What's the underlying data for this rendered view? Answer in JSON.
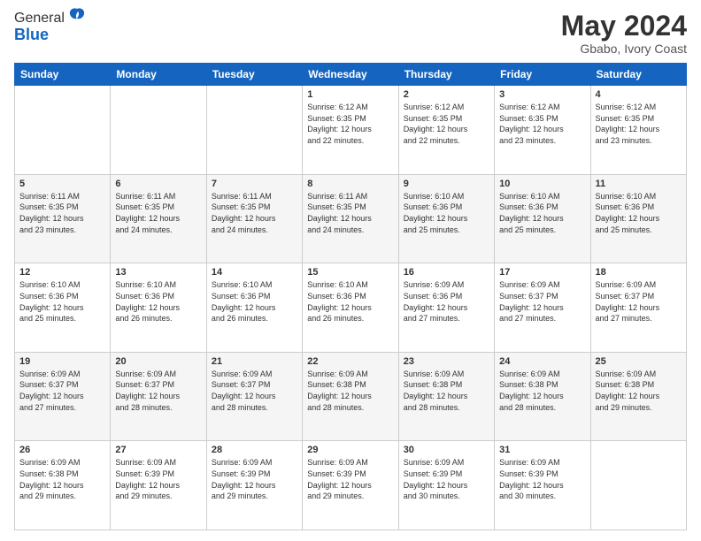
{
  "header": {
    "logo_general": "General",
    "logo_blue": "Blue",
    "title": "May 2024",
    "location": "Gbabo, Ivory Coast"
  },
  "days_of_week": [
    "Sunday",
    "Monday",
    "Tuesday",
    "Wednesday",
    "Thursday",
    "Friday",
    "Saturday"
  ],
  "weeks": [
    [
      {
        "num": "",
        "info": ""
      },
      {
        "num": "",
        "info": ""
      },
      {
        "num": "",
        "info": ""
      },
      {
        "num": "1",
        "info": "Sunrise: 6:12 AM\nSunset: 6:35 PM\nDaylight: 12 hours\nand 22 minutes."
      },
      {
        "num": "2",
        "info": "Sunrise: 6:12 AM\nSunset: 6:35 PM\nDaylight: 12 hours\nand 22 minutes."
      },
      {
        "num": "3",
        "info": "Sunrise: 6:12 AM\nSunset: 6:35 PM\nDaylight: 12 hours\nand 23 minutes."
      },
      {
        "num": "4",
        "info": "Sunrise: 6:12 AM\nSunset: 6:35 PM\nDaylight: 12 hours\nand 23 minutes."
      }
    ],
    [
      {
        "num": "5",
        "info": "Sunrise: 6:11 AM\nSunset: 6:35 PM\nDaylight: 12 hours\nand 23 minutes."
      },
      {
        "num": "6",
        "info": "Sunrise: 6:11 AM\nSunset: 6:35 PM\nDaylight: 12 hours\nand 24 minutes."
      },
      {
        "num": "7",
        "info": "Sunrise: 6:11 AM\nSunset: 6:35 PM\nDaylight: 12 hours\nand 24 minutes."
      },
      {
        "num": "8",
        "info": "Sunrise: 6:11 AM\nSunset: 6:35 PM\nDaylight: 12 hours\nand 24 minutes."
      },
      {
        "num": "9",
        "info": "Sunrise: 6:10 AM\nSunset: 6:36 PM\nDaylight: 12 hours\nand 25 minutes."
      },
      {
        "num": "10",
        "info": "Sunrise: 6:10 AM\nSunset: 6:36 PM\nDaylight: 12 hours\nand 25 minutes."
      },
      {
        "num": "11",
        "info": "Sunrise: 6:10 AM\nSunset: 6:36 PM\nDaylight: 12 hours\nand 25 minutes."
      }
    ],
    [
      {
        "num": "12",
        "info": "Sunrise: 6:10 AM\nSunset: 6:36 PM\nDaylight: 12 hours\nand 25 minutes."
      },
      {
        "num": "13",
        "info": "Sunrise: 6:10 AM\nSunset: 6:36 PM\nDaylight: 12 hours\nand 26 minutes."
      },
      {
        "num": "14",
        "info": "Sunrise: 6:10 AM\nSunset: 6:36 PM\nDaylight: 12 hours\nand 26 minutes."
      },
      {
        "num": "15",
        "info": "Sunrise: 6:10 AM\nSunset: 6:36 PM\nDaylight: 12 hours\nand 26 minutes."
      },
      {
        "num": "16",
        "info": "Sunrise: 6:09 AM\nSunset: 6:36 PM\nDaylight: 12 hours\nand 27 minutes."
      },
      {
        "num": "17",
        "info": "Sunrise: 6:09 AM\nSunset: 6:37 PM\nDaylight: 12 hours\nand 27 minutes."
      },
      {
        "num": "18",
        "info": "Sunrise: 6:09 AM\nSunset: 6:37 PM\nDaylight: 12 hours\nand 27 minutes."
      }
    ],
    [
      {
        "num": "19",
        "info": "Sunrise: 6:09 AM\nSunset: 6:37 PM\nDaylight: 12 hours\nand 27 minutes."
      },
      {
        "num": "20",
        "info": "Sunrise: 6:09 AM\nSunset: 6:37 PM\nDaylight: 12 hours\nand 28 minutes."
      },
      {
        "num": "21",
        "info": "Sunrise: 6:09 AM\nSunset: 6:37 PM\nDaylight: 12 hours\nand 28 minutes."
      },
      {
        "num": "22",
        "info": "Sunrise: 6:09 AM\nSunset: 6:38 PM\nDaylight: 12 hours\nand 28 minutes."
      },
      {
        "num": "23",
        "info": "Sunrise: 6:09 AM\nSunset: 6:38 PM\nDaylight: 12 hours\nand 28 minutes."
      },
      {
        "num": "24",
        "info": "Sunrise: 6:09 AM\nSunset: 6:38 PM\nDaylight: 12 hours\nand 28 minutes."
      },
      {
        "num": "25",
        "info": "Sunrise: 6:09 AM\nSunset: 6:38 PM\nDaylight: 12 hours\nand 29 minutes."
      }
    ],
    [
      {
        "num": "26",
        "info": "Sunrise: 6:09 AM\nSunset: 6:38 PM\nDaylight: 12 hours\nand 29 minutes."
      },
      {
        "num": "27",
        "info": "Sunrise: 6:09 AM\nSunset: 6:39 PM\nDaylight: 12 hours\nand 29 minutes."
      },
      {
        "num": "28",
        "info": "Sunrise: 6:09 AM\nSunset: 6:39 PM\nDaylight: 12 hours\nand 29 minutes."
      },
      {
        "num": "29",
        "info": "Sunrise: 6:09 AM\nSunset: 6:39 PM\nDaylight: 12 hours\nand 29 minutes."
      },
      {
        "num": "30",
        "info": "Sunrise: 6:09 AM\nSunset: 6:39 PM\nDaylight: 12 hours\nand 30 minutes."
      },
      {
        "num": "31",
        "info": "Sunrise: 6:09 AM\nSunset: 6:39 PM\nDaylight: 12 hours\nand 30 minutes."
      },
      {
        "num": "",
        "info": ""
      }
    ]
  ]
}
